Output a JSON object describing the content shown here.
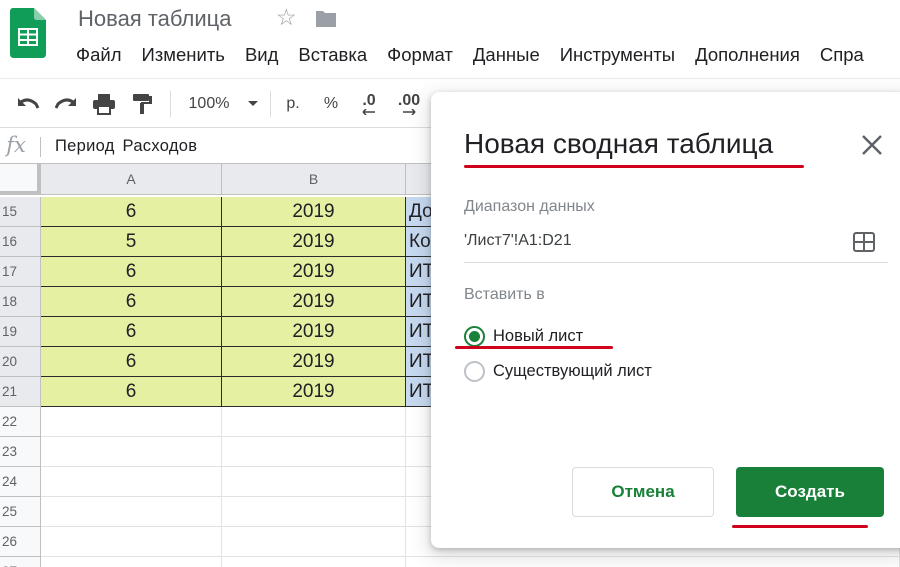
{
  "app": {
    "title": "Новая таблица",
    "menu": [
      "Файл",
      "Изменить",
      "Вид",
      "Вставка",
      "Формат",
      "Данные",
      "Инструменты",
      "Дополнения",
      "Спра"
    ]
  },
  "toolbar": {
    "zoom": "100%",
    "currency": "р.",
    "percent": "%",
    "dec_decrease": ".0",
    "dec_increase": ".00"
  },
  "formula_bar": {
    "fx": "fx",
    "content": "Период Расходов"
  },
  "sheet": {
    "columns": [
      "A",
      "B"
    ],
    "rows": [
      {
        "num": "15",
        "a": "6",
        "b": "2019",
        "c": "До"
      },
      {
        "num": "16",
        "a": "5",
        "b": "2019",
        "c": "Ко"
      },
      {
        "num": "17",
        "a": "6",
        "b": "2019",
        "c": "ИТ"
      },
      {
        "num": "18",
        "a": "6",
        "b": "2019",
        "c": "ИТ"
      },
      {
        "num": "19",
        "a": "6",
        "b": "2019",
        "c": "ИТ"
      },
      {
        "num": "20",
        "a": "6",
        "b": "2019",
        "c": "ИТ"
      },
      {
        "num": "21",
        "a": "6",
        "b": "2019",
        "c": "ИТ"
      }
    ],
    "empty_rows": [
      "22",
      "23",
      "24",
      "25",
      "26",
      "27"
    ]
  },
  "dialog": {
    "title": "Новая сводная таблица",
    "range_label": "Диапазон данных",
    "range_value": "'Лист7'!A1:D21",
    "insert_label": "Вставить в",
    "options": [
      {
        "label": "Новый лист",
        "selected": true
      },
      {
        "label": "Существующий лист",
        "selected": false
      }
    ],
    "cancel_label": "Отмена",
    "create_label": "Создать"
  },
  "colors": {
    "accent_green": "#188038",
    "highlight_yellow": "#e6f0a3",
    "highlight_blue": "#c6d9f0",
    "annotation_red": "#d0021b"
  }
}
